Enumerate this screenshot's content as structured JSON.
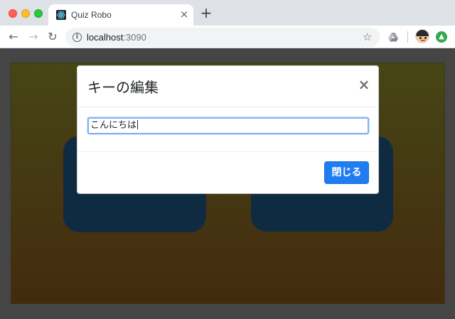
{
  "browser": {
    "tab": {
      "title": "Quiz Robo",
      "close": "×"
    },
    "new_tab": "+",
    "nav": {
      "back": "←",
      "forward": "→",
      "reload": "↻"
    },
    "address": {
      "host": "localhost",
      "port": ":3090"
    },
    "bookmark_star": "☆",
    "info": "i"
  },
  "modal": {
    "title": "キーの編集",
    "close": "×",
    "input_value": "こんにちは",
    "button_label": "閉じる"
  },
  "colors": {
    "accent": "#1f7df0",
    "card": "#1f5783",
    "stage_top": "#8c8c2c",
    "stage_bottom": "#86561c"
  }
}
